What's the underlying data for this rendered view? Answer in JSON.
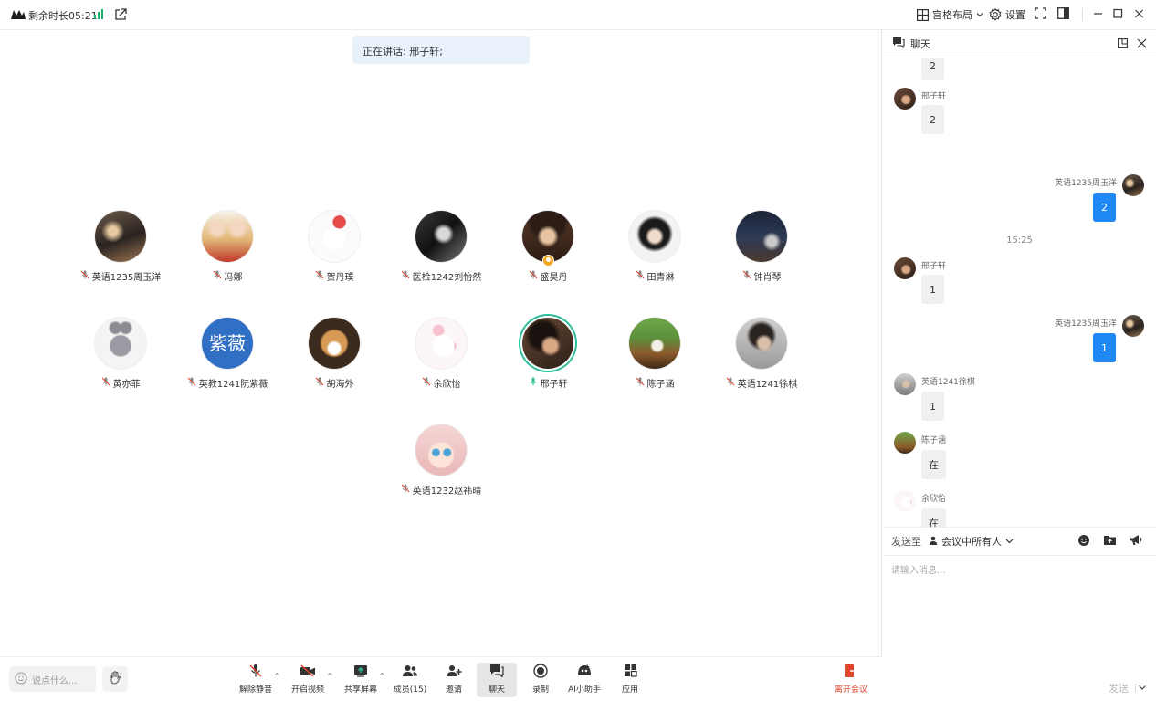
{
  "topbar": {
    "remaining": "剩余时长05:21",
    "layout_label": "宫格布局",
    "settings_label": "设置"
  },
  "stage": {
    "speaking": "正在讲话: 邢子轩;",
    "participants": [
      {
        "name": "英语1235周玉洋"
      },
      {
        "name": "冯娜"
      },
      {
        "name": "贺丹璞"
      },
      {
        "name": "医检1242刘怡然"
      },
      {
        "name": "盛昊丹"
      },
      {
        "name": "田青淋"
      },
      {
        "name": "钟肖琴"
      },
      {
        "name": "黄亦菲"
      },
      {
        "name": "英教1241阮紫薇",
        "avatar_text": "紫薇"
      },
      {
        "name": "胡海外"
      },
      {
        "name": "余欣怡"
      },
      {
        "name": "邢子轩"
      },
      {
        "name": "陈子涵"
      },
      {
        "name": "英语1241徐棋"
      },
      {
        "name": "英语1232赵祎晴"
      }
    ]
  },
  "toolbar": {
    "say_placeholder": "说点什么...",
    "unmute": "解除静音",
    "start_video": "开启视频",
    "share_screen": "共享屏幕",
    "members": "成员(15)",
    "invite": "邀请",
    "chat": "聊天",
    "record": "录制",
    "ai_assistant": "AI小助手",
    "apps": "应用",
    "leave": "离开会议"
  },
  "chat": {
    "title": "聊天",
    "top_partial_bubble": "2",
    "timestamp": "15:25",
    "messages": [
      {
        "sender": "邢子轩",
        "text": "2",
        "mine": false
      },
      {
        "sender": "英语1235周玉洋",
        "text": "2",
        "mine": true
      },
      {
        "sender": "邢子轩",
        "text": "1",
        "mine": false
      },
      {
        "sender": "英语1235周玉洋",
        "text": "1",
        "mine": true
      },
      {
        "sender": "英语1241徐棋",
        "text": "1",
        "mine": false
      },
      {
        "sender": "陈子涵",
        "text": "在",
        "mine": false
      },
      {
        "sender": "余欣怡",
        "text": "在",
        "mine": false
      }
    ],
    "send_to_label": "发送至",
    "send_target": "会议中所有人",
    "input_placeholder": "请输入消息...",
    "send_button": "发送"
  },
  "colors": {
    "accent_blue": "#1e88f5",
    "speaking_ring": "#2ebd9a",
    "leave_red": "#e0442c",
    "speaking_bg": "#e9f1fb"
  }
}
